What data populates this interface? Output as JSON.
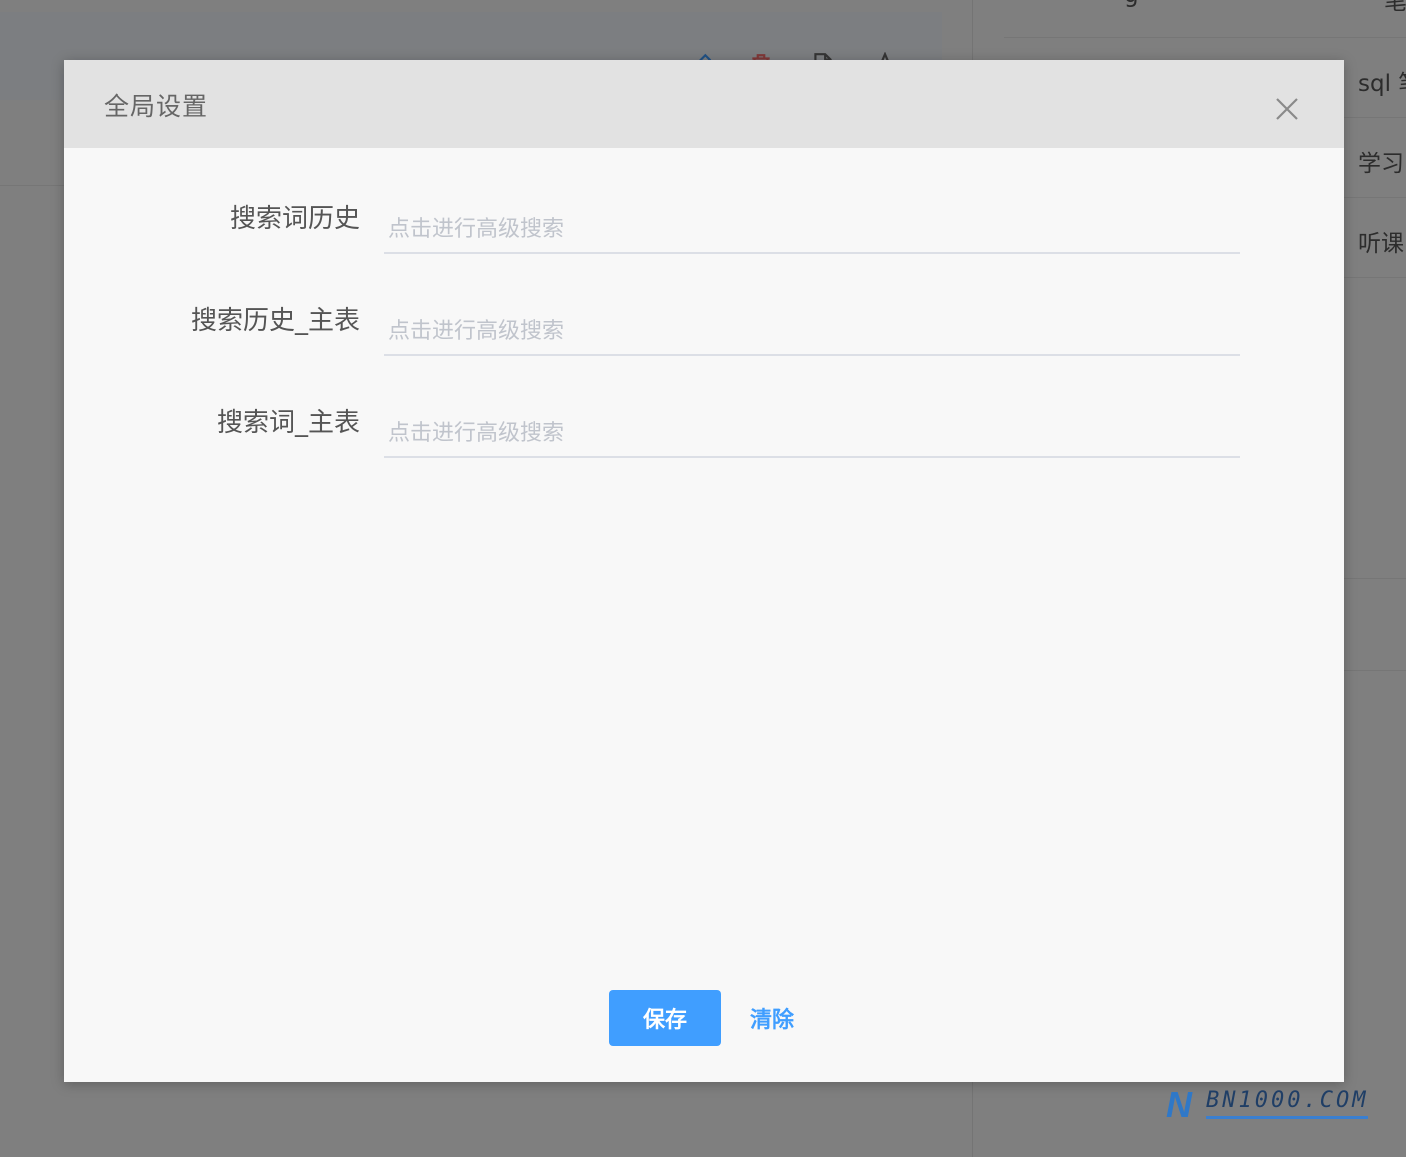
{
  "background": {
    "right_list": [
      {
        "label": "g"
      },
      {
        "label": "笔"
      },
      {
        "label": "sql 笔"
      },
      {
        "label": "学习"
      },
      {
        "label": "听课"
      }
    ]
  },
  "modal": {
    "title": "全局设置",
    "fields": [
      {
        "label": "搜索词历史",
        "value": "",
        "placeholder": "点击进行高级搜索"
      },
      {
        "label": "搜索历史_主表",
        "value": "",
        "placeholder": "点击进行高级搜索"
      },
      {
        "label": "搜索词_主表",
        "value": "",
        "placeholder": "点击进行高级搜索"
      }
    ],
    "save_label": "保存",
    "clear_label": "清除"
  },
  "watermark": {
    "mark": "N",
    "text": "BN1000.COM"
  },
  "colors": {
    "primary": "#409eff",
    "header_bg": "#e2e2e2",
    "modal_bg": "#f8f8f8",
    "overlay": "rgba(0,0,0,0.48)"
  }
}
